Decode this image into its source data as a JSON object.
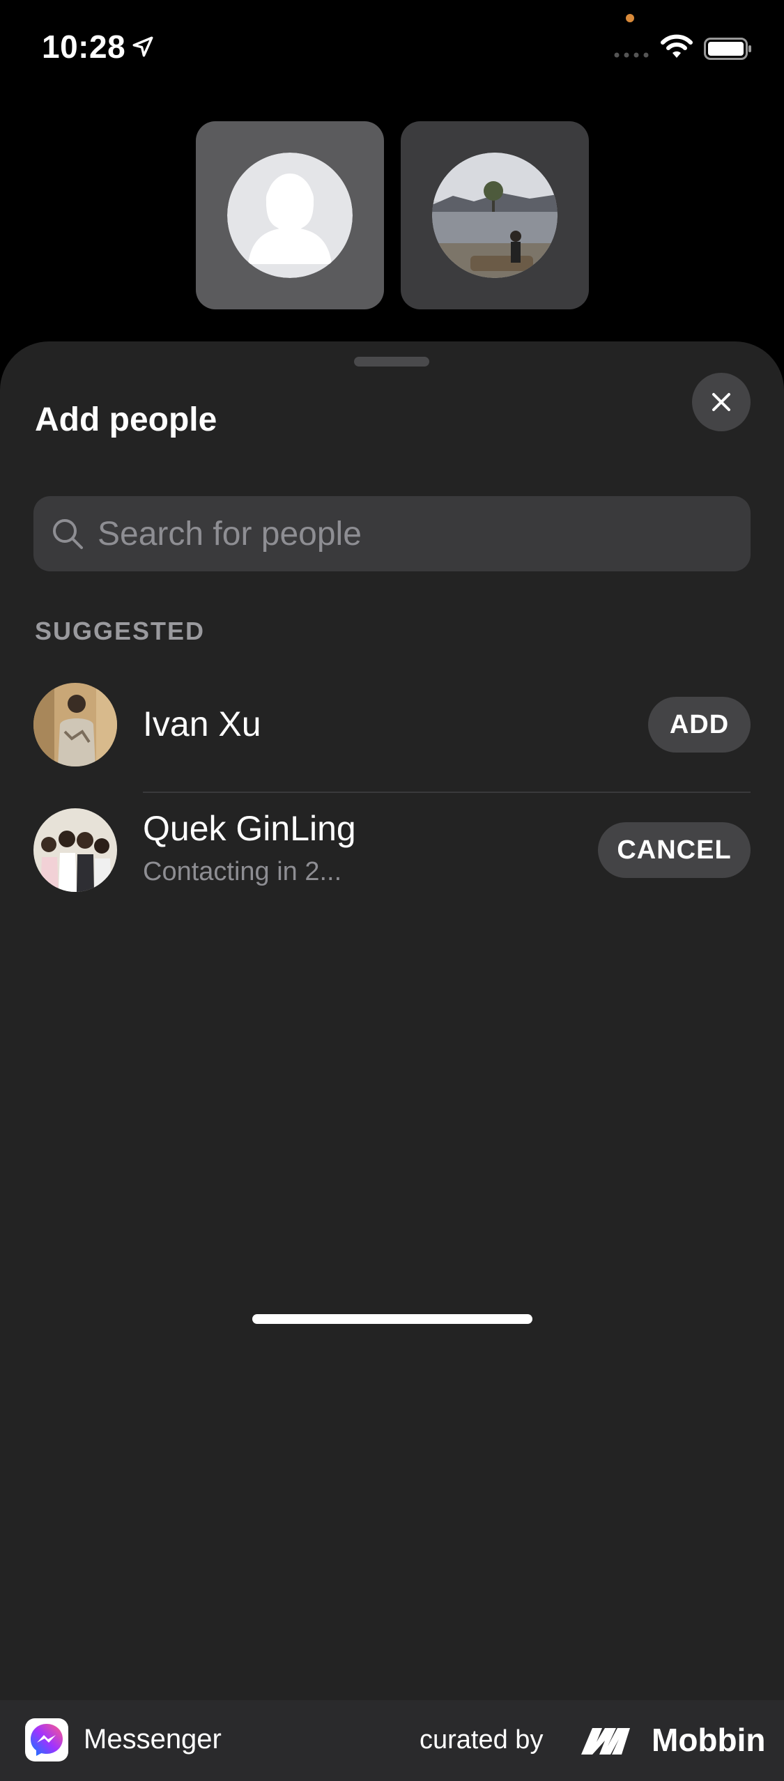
{
  "status_bar": {
    "time": "10:28"
  },
  "sheet": {
    "title": "Add people",
    "search_placeholder": "Search for people",
    "section_label": "SUGGESTED"
  },
  "suggestions": [
    {
      "name": "Ivan Xu",
      "action": "ADD"
    },
    {
      "name": "Quek GinLing",
      "subtitle": "Contacting in 2...",
      "action": "CANCEL"
    }
  ],
  "footer": {
    "app_name": "Messenger",
    "curated_by": "curated by",
    "brand": "Mobbin"
  },
  "colors": {
    "sheet_bg": "#232323",
    "pill_bg": "#444446",
    "search_bg": "#3a3a3c"
  }
}
